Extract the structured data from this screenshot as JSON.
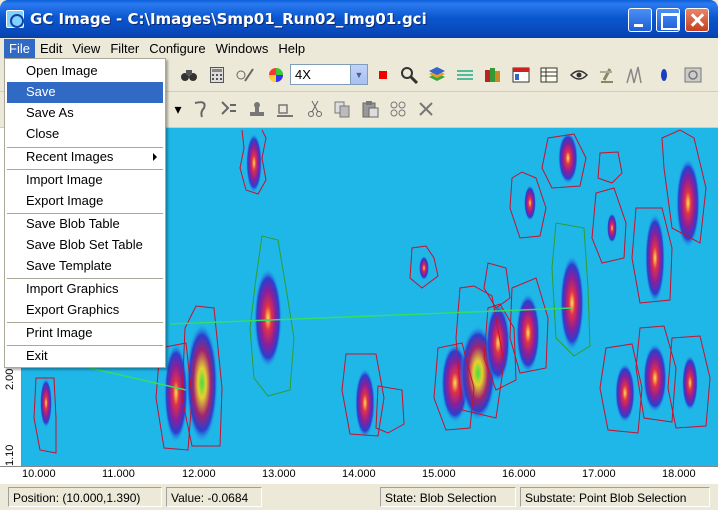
{
  "window": {
    "title": "GC Image - C:\\Images\\Smp01_Run02_Img01.gci"
  },
  "menubar": {
    "items": [
      "File",
      "Edit",
      "View",
      "Filter",
      "Configure",
      "Windows",
      "Help"
    ]
  },
  "file_menu": {
    "items": [
      {
        "label": "Open Image"
      },
      {
        "label": "Save",
        "highlighted": true
      },
      {
        "label": "Save As"
      },
      {
        "label": "Close"
      },
      {
        "label": "Recent Images",
        "submenu": true
      },
      {
        "label": "Import Image"
      },
      {
        "label": "Export Image"
      },
      {
        "label": "Save Blob Table"
      },
      {
        "label": "Save Blob Set Table"
      },
      {
        "label": "Save Template"
      },
      {
        "label": "Import Graphics"
      },
      {
        "label": "Export Graphics"
      },
      {
        "label": "Print Image"
      },
      {
        "label": "Exit"
      }
    ]
  },
  "toolbar": {
    "zoom_value": "4X",
    "icons": [
      "binoculars-icon",
      "calculator-icon",
      "pencil-icon",
      "colormap-icon",
      "stop-icon",
      "magnify-icon",
      "layers-icon",
      "baseline-icon",
      "books-icon",
      "table-icon",
      "chart-icon",
      "eye-icon",
      "microscope-icon",
      "peaks-icon",
      "blob-icon",
      "camera-icon"
    ],
    "edit_icons": [
      "lasso-icon",
      "merge-icon",
      "stamp-icon",
      "erase-icon",
      "cut-icon",
      "copy-icon",
      "paste-icon",
      "group-icon",
      "delete-icon"
    ]
  },
  "plot": {
    "x_ticks": [
      "10.000",
      "11.000",
      "12.000",
      "13.000",
      "14.000",
      "15.000",
      "16.000",
      "17.000",
      "18.000"
    ],
    "y_ticks": [
      "1.10",
      "2.00"
    ],
    "colors": {
      "background": "#1fb7e8",
      "blob_outline": "#c8102e",
      "selected_outline": "#2e9e2e",
      "link_line": "#33dd66"
    }
  },
  "statusbar": {
    "position": "Position: (10.000,1.390)",
    "value": "Value: -0.0684",
    "state": "State: Blob Selection",
    "substate": "Substate: Point Blob Selection"
  }
}
